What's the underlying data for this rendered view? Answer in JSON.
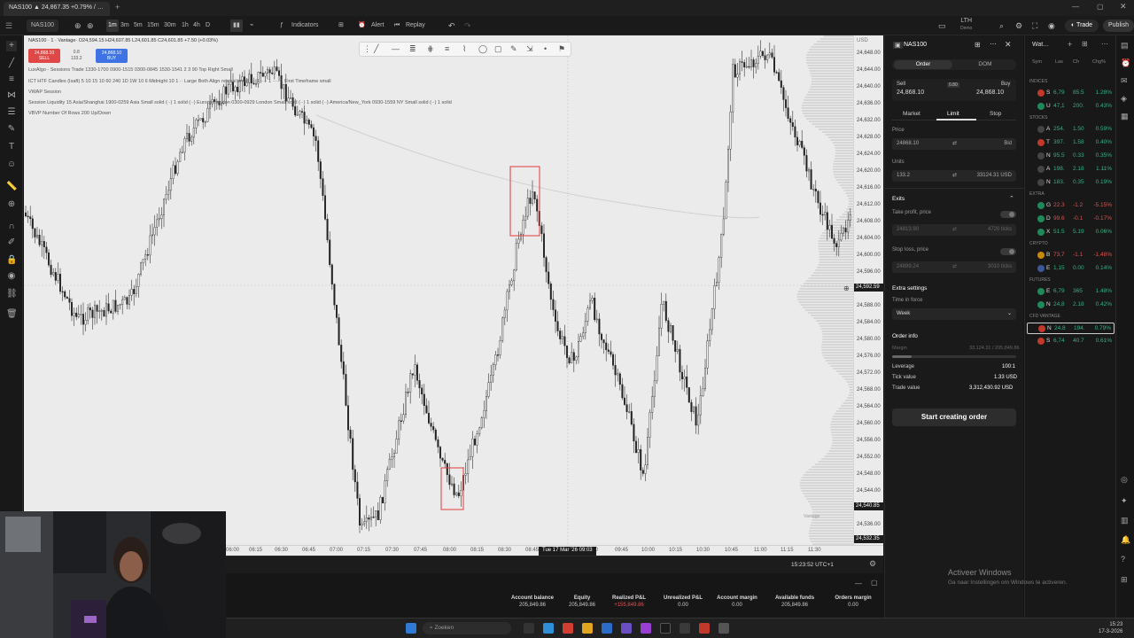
{
  "browser": {
    "tab_title": "NAS100 ▲ 24,867.35 +0.79% / …"
  },
  "toolbar": {
    "symbol": "NAS100",
    "timeframes": [
      "1m",
      "3m",
      "5m",
      "15m",
      "30m",
      "1h",
      "4h",
      "D"
    ],
    "indicators": "Indicators",
    "alert": "Alert",
    "replay": "Replay",
    "account": "LTH",
    "account_sub": "Demo",
    "trade": "Trade",
    "publish": "Publish"
  },
  "chart": {
    "header": "NAS100 · 1 · Vantage·  O24,594.15 H24,607.85 L24,601.85 C24,601.85 +7.50 (+0.03%)",
    "sell_price": "24,868.10",
    "sell_label": "SELL",
    "spread": "0.8",
    "qty": "133.2",
    "buy_price": "24,868.10",
    "buy_label": "BUY",
    "legend": [
      "LuxAlgo - Sessions Trade 1330-1700 0900-1515 0300-0845 1530-1541 2 3 90 Top Right Small",
      "ICT HTF Candles (Isaft) 5 10 15 10 60 240 1D 1W 10 6 Midnight 10 1 ·· Large Both Align normal small ··· 1 ···· 1 ···· 1 First Timeframe small",
      "VWAP Session",
      "Session Liquidity 15 Asia/Shanghai 1900-0259 Asia Small solid (··) 1 solid (··) Europe/London 0300-0929 London Small solid (··) 1 solid (··) America/New_York 0930-1559 NY Small solid (··) 1 solid",
      "VBVP Number Of Rows 200 Up/Down"
    ],
    "price_labels": [
      "24,648.00",
      "24,644.00",
      "24,640.00",
      "24,636.00",
      "24,632.00",
      "24,628.00",
      "24,624.00",
      "24,620.00",
      "24,616.00",
      "24,612.00",
      "24,608.00",
      "24,604.00",
      "24,600.00",
      "24,596.00",
      "24,592.00",
      "24,588.00",
      "24,584.00",
      "24,580.00",
      "24,576.00",
      "24,572.00",
      "24,568.00",
      "24,564.00",
      "24,560.00",
      "24,556.00",
      "24,552.00",
      "24,548.00",
      "24,544.00",
      "24,540.00",
      "24,536.00",
      "24,532.00"
    ],
    "current_price": "24,592.59",
    "low_price": "24,540.85",
    "bottom_price": "24,532.35",
    "currency": "USD",
    "time_labels": [
      "06:00",
      "06:15",
      "06:30",
      "06:45",
      "07:00",
      "07:15",
      "07:30",
      "07:45",
      "08:00",
      "08:15",
      "08:30",
      "08:45",
      "09:15",
      "09:30",
      "09:45",
      "10:00",
      "10:15",
      "10:30",
      "10:45",
      "11:00",
      "11:15",
      "11:30"
    ],
    "crosshair_time": "Tue 17 Mar '26  09:03",
    "clock": "15:23:52 UTC+1",
    "watermark": "Vantage"
  },
  "account": [
    {
      "label": "Account balance",
      "value": "205,849.86"
    },
    {
      "label": "Equity",
      "value": "205,849.86"
    },
    {
      "label": "Realized P&L",
      "value": "+155,849.86"
    },
    {
      "label": "Unrealized P&L",
      "value": "0.00"
    },
    {
      "label": "Account margin",
      "value": "0.00"
    },
    {
      "label": "Available funds",
      "value": "205,849.86"
    },
    {
      "label": "Orders margin",
      "value": "0.00"
    }
  ],
  "order": {
    "symbol": "NAS100",
    "tab_order": "Order",
    "tab_dom": "DOM",
    "sell_label": "Sell",
    "sell_price": "24,868.10",
    "spread": "0.80",
    "buy_label": "Buy",
    "buy_price": "24,868.10",
    "types": [
      "Market",
      "Limit",
      "Stop"
    ],
    "price_label": "Price",
    "price_value": "24868.10",
    "price_suffix": "Bid",
    "units_label": "Units",
    "units_value": "133.2",
    "units_usd": "33124.31 USD",
    "exits_label": "Exits",
    "tp_label": "Take profit, price",
    "tp_value": "24813.90",
    "tp_ticks": "4720 ticks",
    "sl_label": "Stop loss, price",
    "sl_value": "24899.24",
    "sl_ticks": "3010 ticks",
    "extra_label": "Extra settings",
    "tif_label": "Time in force",
    "tif_value": "Week",
    "info_label": "Order info",
    "margin_label": "Margin",
    "margin_value": "33,124.31 / 205,849.86",
    "leverage_label": "Leverage",
    "leverage_value": "100:1",
    "tick_label": "Tick value",
    "tick_value": "1.33 USD",
    "trade_label": "Trade value",
    "trade_value": "3,312,430.92 USD",
    "cta": "Start creating order"
  },
  "watchlist": {
    "title": "Wat…",
    "cols": [
      "Sym",
      "Las",
      "Ch",
      "Chg%"
    ],
    "rows": [
      {
        "section": "INDICES"
      },
      {
        "sym": "S",
        "last": "6,79",
        "chg": "85.5",
        "pct": "1.28%",
        "dir": "up",
        "badge": "#c0392b"
      },
      {
        "sym": "U",
        "last": "47,1",
        "chg": "200.",
        "pct": "0.43%",
        "dir": "up",
        "badge": "#1e8a5a"
      },
      {
        "section": "STOCKS"
      },
      {
        "sym": "A",
        "last": "254.",
        "chg": "1.50",
        "pct": "0.59%",
        "dir": "up",
        "badge": "#444"
      },
      {
        "sym": "T",
        "last": "397.",
        "chg": "1.58",
        "pct": "0.40%",
        "dir": "up",
        "badge": "#c0392b"
      },
      {
        "sym": "N",
        "last": "95.5",
        "chg": "0.33",
        "pct": "0.35%",
        "dir": "up",
        "badge": "#444"
      },
      {
        "sym": "A",
        "last": "198.",
        "chg": "2.18",
        "pct": "1.11%",
        "dir": "up",
        "badge": "#444"
      },
      {
        "sym": "N",
        "last": "183.",
        "chg": "0.35",
        "pct": "0.19%",
        "dir": "up",
        "badge": "#444"
      },
      {
        "section": "EXTRA"
      },
      {
        "sym": "G",
        "last": "22.3",
        "chg": "-1.2",
        "pct": "-5.15%",
        "dir": "down",
        "badge": "#1e8a5a"
      },
      {
        "sym": "D",
        "last": "99.6",
        "chg": "-0.1",
        "pct": "-0.17%",
        "dir": "down",
        "badge": "#1e8a5a"
      },
      {
        "sym": "X",
        "last": "51.5",
        "chg": "5.19",
        "pct": "0.06%",
        "dir": "up",
        "badge": "#1e8a5a"
      },
      {
        "section": "CRYPTO"
      },
      {
        "sym": "B",
        "last": "73,7",
        "chg": "-1.1",
        "pct": "-1.48%",
        "dir": "down",
        "badge": "#c78a00"
      },
      {
        "sym": "E",
        "last": "1,15",
        "chg": "0.00",
        "pct": "0.14%",
        "dir": "up",
        "badge": "#3b5998"
      },
      {
        "section": "FUTURES"
      },
      {
        "sym": "E",
        "last": "6,79",
        "chg": "365",
        "pct": "1.48%",
        "dir": "up",
        "badge": "#1e8a5a"
      },
      {
        "sym": "N",
        "last": "24,8",
        "chg": "2.18",
        "pct": "0.42%",
        "dir": "up",
        "badge": "#1e8a5a"
      },
      {
        "section": "CFD VANTAGE"
      },
      {
        "sym": "N",
        "last": "24,8",
        "chg": "194.",
        "pct": "0.79%",
        "dir": "up",
        "badge": "#c0392b",
        "selected": true
      },
      {
        "sym": "S",
        "last": "6,74",
        "chg": "40.7",
        "pct": "0.61%",
        "dir": "up",
        "badge": "#c0392b"
      }
    ]
  },
  "windows": {
    "activate_title": "Activeer Windows",
    "activate_sub": "Ga naar Instellingen om Windows te activeren.",
    "search": "Zoeken",
    "time": "15:23",
    "date": "17-3-2026"
  }
}
